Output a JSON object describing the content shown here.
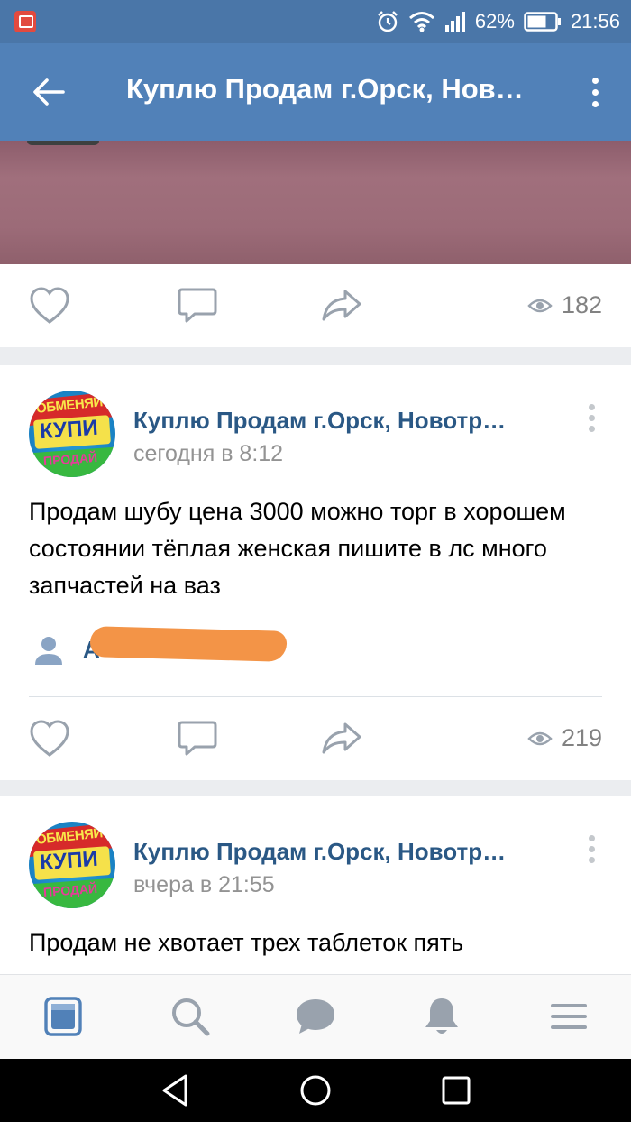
{
  "status_bar": {
    "battery": "62%",
    "time": "21:56"
  },
  "app_bar": {
    "title": "Куплю Продам г.Орск, Нов…"
  },
  "post1": {
    "views": "182"
  },
  "post2": {
    "group": "Куплю Продам г.Орск, Новотр…",
    "time": "сегодня в 8:12",
    "text": "Продам шубу цена 3000 можно торг в хорошем состоянии тёплая женская пишите в лс много запчастей на ваз",
    "author_initial": "А",
    "views": "219"
  },
  "post3": {
    "group": "Куплю Продам г.Орск, Новотр…",
    "time": "вчера в 21:55",
    "text": "Продам не хвотает трех таблеток пять"
  },
  "avatar": {
    "top": "ОБМЕНЯЙ",
    "middle": "КУПИ",
    "bottom": "ПРОДАЙ"
  },
  "colors": {
    "header": "#5181b8",
    "status": "#4a76a8",
    "link": "#2a5885",
    "redaction": "#f39447"
  },
  "icons": [
    "back-icon",
    "more-icon",
    "heart-icon",
    "comment-icon",
    "share-icon",
    "eye-icon",
    "news-icon",
    "search-icon",
    "messages-icon",
    "bell-icon",
    "menu-icon"
  ]
}
